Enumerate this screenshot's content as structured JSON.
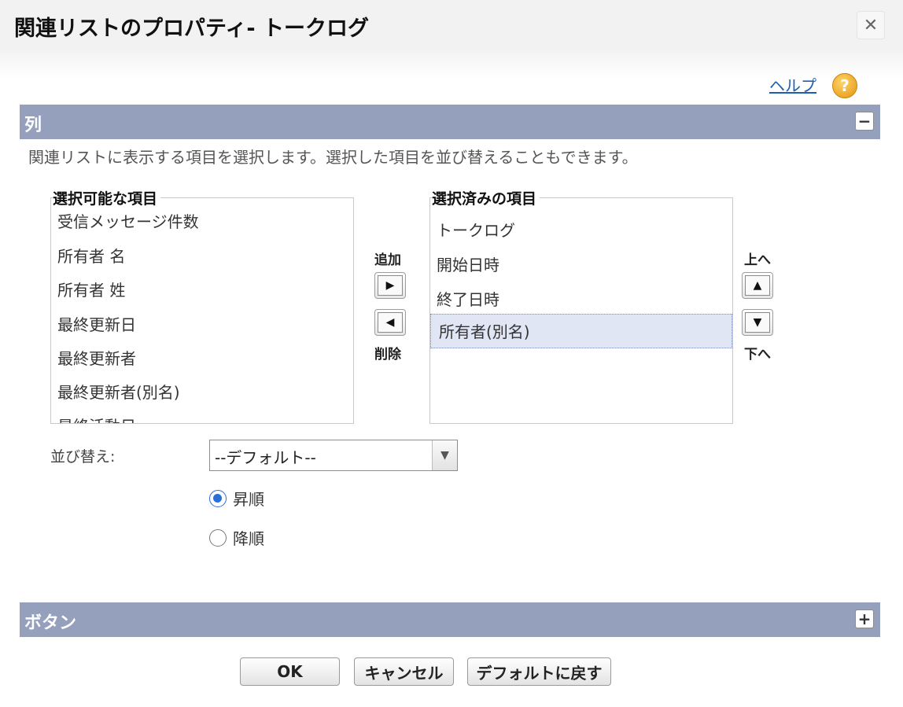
{
  "dialog": {
    "title": "関連リストのプロパティ- トークログ",
    "close_label": "✕"
  },
  "help": {
    "link_label": "ヘルプ",
    "icon_label": "?"
  },
  "columns_section": {
    "label": "列",
    "toggle": "−",
    "instructions": "関連リストに表示する項目を選択します。選択した項目を並び替えることもできます。",
    "available": {
      "label": "選択可能な項目",
      "items": [
        "受信メッセージ件数",
        "所有者 名",
        "所有者 姓",
        "最終更新日",
        "最終更新者",
        "最終更新者(別名)",
        "最終活動日"
      ]
    },
    "selected": {
      "label": "選択済みの項目",
      "items": [
        "トークログ",
        "開始日時",
        "終了日時",
        "所有者(別名)"
      ],
      "highlighted_item": "所有者(別名)"
    },
    "add_label": "追加",
    "remove_label": "削除",
    "up_label": "上へ",
    "down_label": "下へ",
    "sort": {
      "label": "並び替え:",
      "value": "--デフォルト--",
      "ascending_label": "昇順",
      "descending_label": "降順",
      "selected_order": "昇順"
    }
  },
  "buttons_section": {
    "label": "ボタン",
    "toggle": "+"
  },
  "footer": {
    "ok_label": "OK",
    "cancel_label": "キャンセル",
    "default_label": "デフォルトに戻す"
  },
  "icons": {
    "add": "arrow-right-icon",
    "remove": "arrow-left-icon",
    "up": "arrow-up-icon",
    "down": "arrow-down-icon",
    "help": "question-circle-icon",
    "close": "close-icon",
    "select": "chevron-down-icon"
  },
  "colors": {
    "section_bar": "#95a0bd",
    "link": "#1a5fb4",
    "help_icon": "#f0a81b",
    "selected_row": "#e0e6f4",
    "radio_checked": "#2a6fd6"
  }
}
